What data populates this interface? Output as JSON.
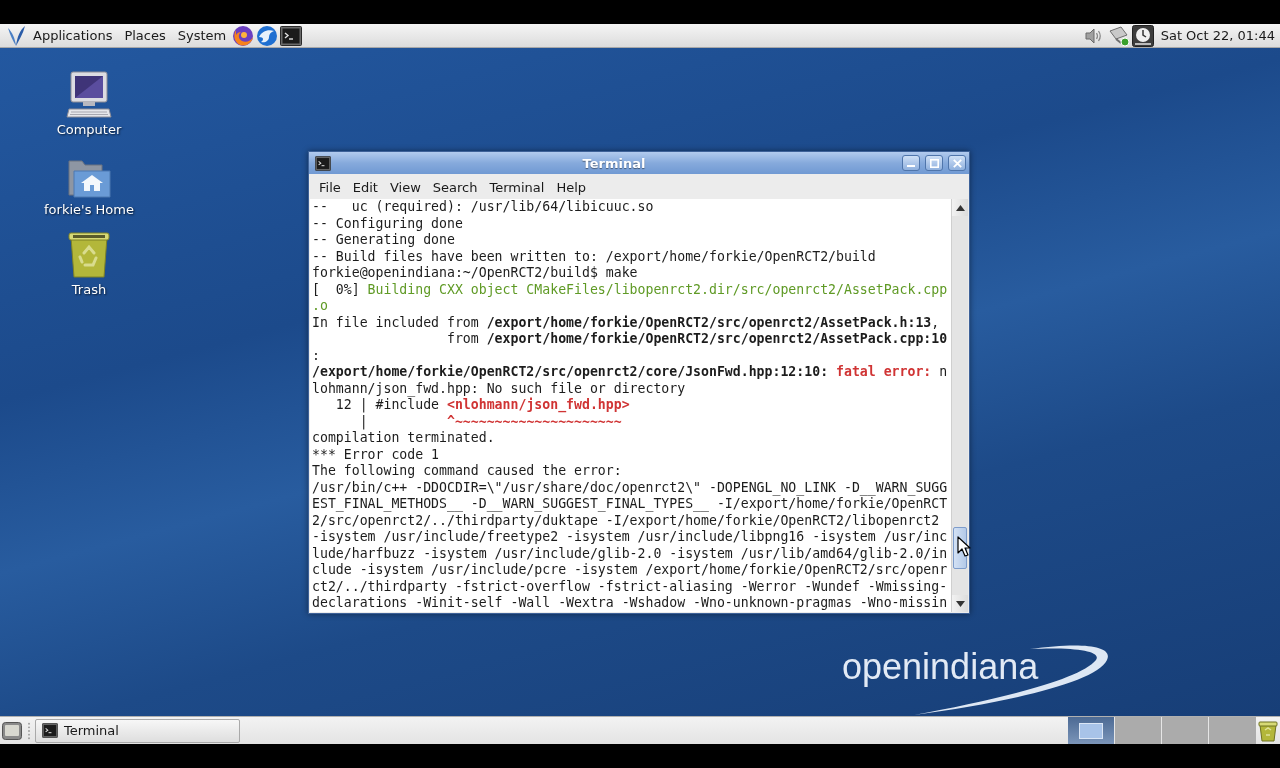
{
  "top_panel": {
    "menus": [
      "Applications",
      "Places",
      "System"
    ],
    "clock": "Sat Oct 22, 01:44"
  },
  "desktop_icons": [
    {
      "kind": "computer",
      "label": "Computer"
    },
    {
      "kind": "home",
      "label": "forkie's Home"
    },
    {
      "kind": "trash",
      "label": "Trash"
    }
  ],
  "window": {
    "title": "Terminal",
    "menus": [
      "File",
      "Edit",
      "View",
      "Search",
      "Terminal",
      "Help"
    ],
    "lines": [
      [
        {
          "text": "--   uc (required): /usr/lib/64/libicuuc.so",
          "kind": "text"
        }
      ],
      [
        {
          "text": "-- Configuring done",
          "kind": "text"
        }
      ],
      [
        {
          "text": "-- Generating done",
          "kind": "text"
        }
      ],
      [
        {
          "text": "-- Build files have been written to: /export/home/forkie/OpenRCT2/build",
          "kind": "text"
        }
      ],
      [
        {
          "text": "forkie@openindiana:~/OpenRCT2/build$ make",
          "kind": "text"
        }
      ],
      [
        {
          "text": "[  0%] ",
          "kind": "text"
        },
        {
          "text": "Building CXX object CMakeFiles/libopenrct2.dir/src/openrct2/AssetPack.cpp",
          "kind": "step"
        }
      ],
      [
        {
          "text": ".o",
          "kind": "step"
        }
      ],
      [
        {
          "text": "In file included from ",
          "kind": "text"
        },
        {
          "text": "/export/home/forkie/OpenRCT2/src/openrct2/AssetPack.h:13",
          "kind": "path"
        },
        {
          "text": ",",
          "kind": "text"
        }
      ],
      [
        {
          "text": "                 from ",
          "kind": "text"
        },
        {
          "text": "/export/home/forkie/OpenRCT2/src/openrct2/AssetPack.cpp:10",
          "kind": "path"
        }
      ],
      [
        {
          "text": ":",
          "kind": "text"
        }
      ],
      [
        {
          "text": "/export/home/forkie/OpenRCT2/src/openrct2/core/JsonFwd.hpp:12:10: ",
          "kind": "path"
        },
        {
          "text": "fatal error:",
          "kind": "error"
        },
        {
          "text": " n",
          "kind": "text"
        }
      ],
      [
        {
          "text": "lohmann/json_fwd.hpp: No such file or directory",
          "kind": "text"
        }
      ],
      [
        {
          "text": "   12 | #include ",
          "kind": "text"
        },
        {
          "text": "<nlohmann/json_fwd.hpp>",
          "kind": "error"
        }
      ],
      [
        {
          "text": "      |          ",
          "kind": "text"
        },
        {
          "text": "^~~~~~~~~~~~~~~~~~~~~~",
          "kind": "error"
        }
      ],
      [
        {
          "text": "compilation terminated.",
          "kind": "text"
        }
      ],
      [
        {
          "text": "*** Error code 1",
          "kind": "text"
        }
      ],
      [
        {
          "text": "The following command caused the error:",
          "kind": "text"
        }
      ],
      [
        {
          "text": "/usr/bin/c++ -DDOCDIR=\\\"/usr/share/doc/openrct2\\\" -DOPENGL_NO_LINK -D__WARN_SUGG",
          "kind": "text"
        }
      ],
      [
        {
          "text": "EST_FINAL_METHODS__ -D__WARN_SUGGEST_FINAL_TYPES__ -I/export/home/forkie/OpenRCT",
          "kind": "text"
        }
      ],
      [
        {
          "text": "2/src/openrct2/../thirdparty/duktape -I/export/home/forkie/OpenRCT2/libopenrct2",
          "kind": "text"
        }
      ],
      [
        {
          "text": "-isystem /usr/include/freetype2 -isystem /usr/include/libpng16 -isystem /usr/inc",
          "kind": "text"
        }
      ],
      [
        {
          "text": "lude/harfbuzz -isystem /usr/include/glib-2.0 -isystem /usr/lib/amd64/glib-2.0/in",
          "kind": "text"
        }
      ],
      [
        {
          "text": "clude -isystem /usr/include/pcre -isystem /export/home/forkie/OpenRCT2/src/openr",
          "kind": "text"
        }
      ],
      [
        {
          "text": "ct2/../thirdparty -fstrict-overflow -fstrict-aliasing -Werror -Wundef -Wmissing-",
          "kind": "text"
        }
      ],
      [
        {
          "text": "declarations -Winit-self -Wall -Wextra -Wshadow -Wno-unknown-pragmas -Wno-missin",
          "kind": "text"
        }
      ]
    ]
  },
  "logo": {
    "text": "openindiana"
  },
  "bottom_panel": {
    "tasks": [
      {
        "label": "Terminal"
      }
    ],
    "workspaces": [
      {
        "selected": true,
        "has_window": true
      },
      {
        "selected": false,
        "has_window": false
      },
      {
        "selected": false,
        "has_window": false
      },
      {
        "selected": false,
        "has_window": false
      }
    ]
  }
}
